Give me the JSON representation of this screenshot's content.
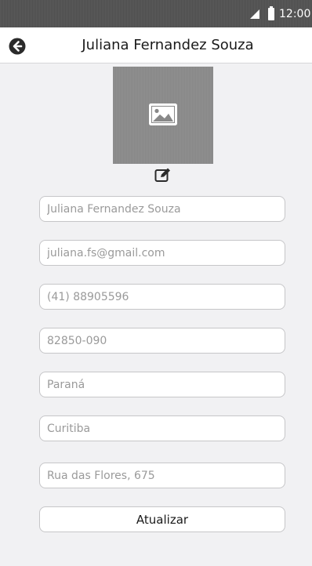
{
  "status_bar": {
    "time": "12:00",
    "icons": [
      "signal-icon",
      "battery-icon"
    ]
  },
  "header": {
    "title": "Juliana Fernandez Souza",
    "back_icon": "arrow-left-circle-icon"
  },
  "profile": {
    "photo_icon": "image-placeholder-icon",
    "edit_icon": "edit-icon"
  },
  "form": {
    "name": "Juliana Fernandez Souza",
    "email": "juliana.fs@gmail.com",
    "phone": "(41) 88905596",
    "zip": "82850-090",
    "state": "Paraná",
    "city": "Curitiba",
    "address": "Rua das Flores, 675",
    "submit_label": "Atualizar"
  },
  "colors": {
    "background": "#f1f1f3",
    "status_bar": "#555555",
    "photo_placeholder": "#8c8c8c",
    "field_border": "#c6c6c8",
    "field_text": "#9a9a9a"
  }
}
